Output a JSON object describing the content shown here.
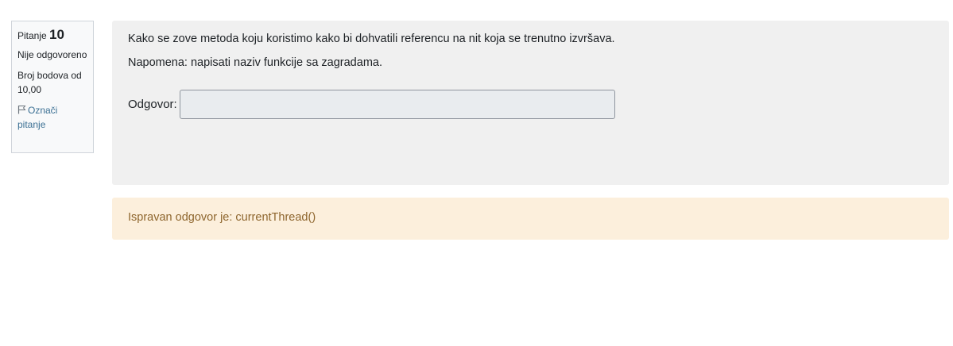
{
  "question_info": {
    "label": "Pitanje",
    "number": "10",
    "state": "Nije odgovoreno",
    "grade": "Broj bodova od 10,00",
    "flag_label": "Označi pitanje",
    "flag_icon": "flag-icon"
  },
  "formulation": {
    "question_text": "Kako se zove metoda koju koristimo kako bi dohvatili referencu na nit koja se trenutno izvršava.",
    "note_text": "Napomena: napisati naziv funkcije sa zagradama.",
    "answer_label": "Odgovor:",
    "answer_value": ""
  },
  "feedback": {
    "right_answer": "Ispravan odgovor je: currentThread()"
  }
}
